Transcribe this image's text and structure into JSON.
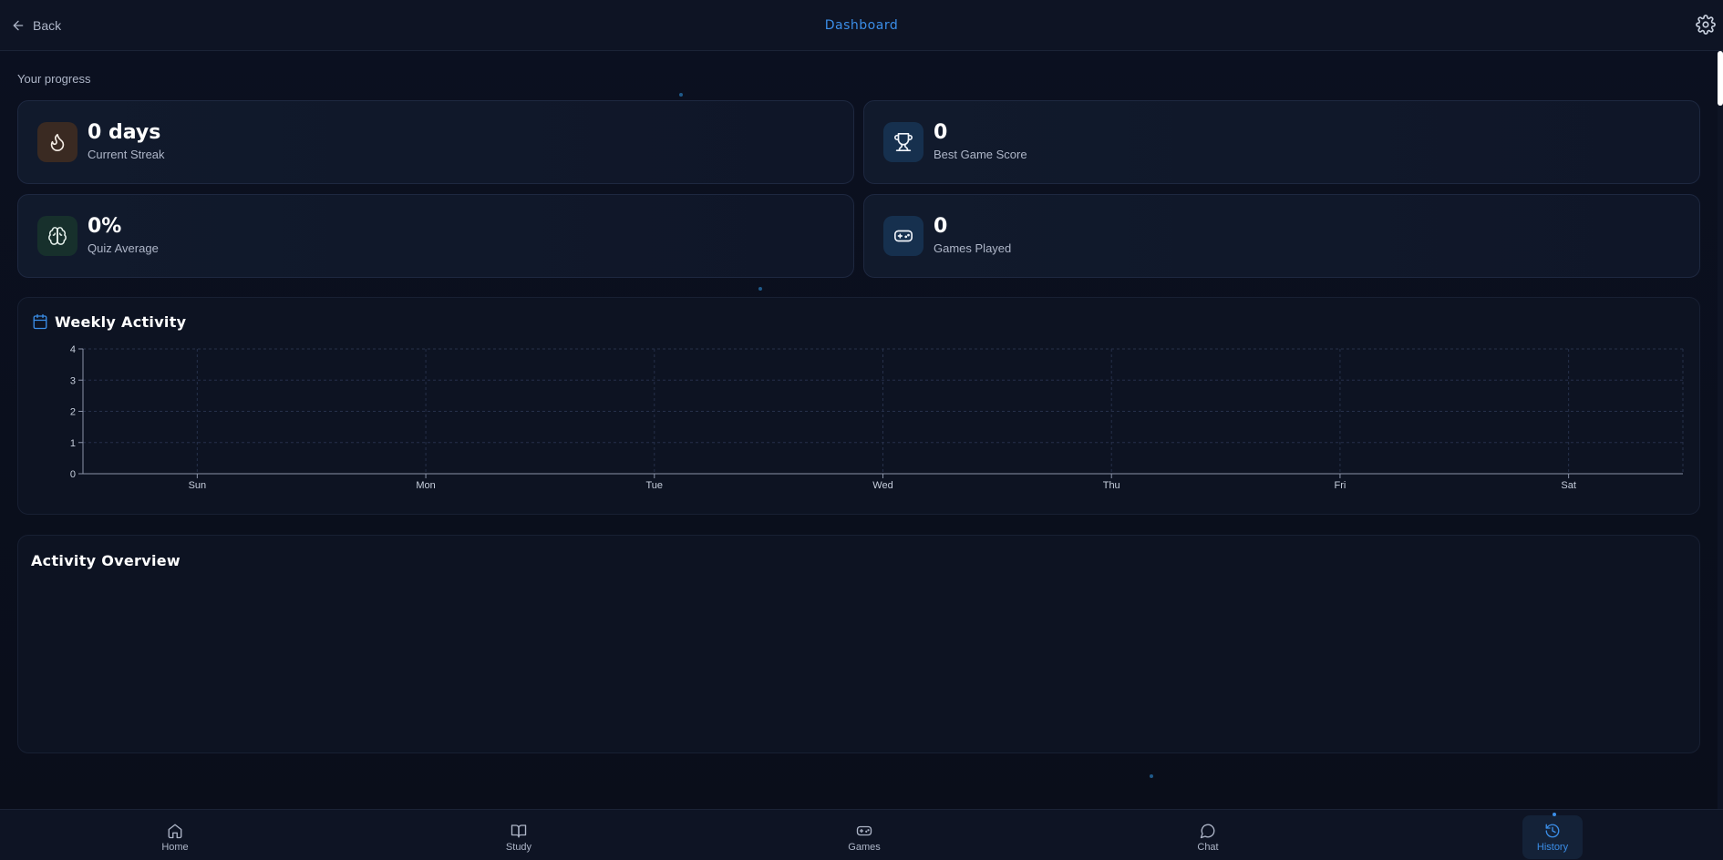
{
  "header": {
    "back_label": "Back",
    "title": "Dashboard"
  },
  "progress": {
    "section_label": "Your progress",
    "stats": [
      {
        "value": "0 days",
        "label": "Current Streak",
        "icon": "flame-icon",
        "color": "#f08a3c"
      },
      {
        "value": "0",
        "label": "Best Game Score",
        "icon": "trophy-icon",
        "color": "#3b8ee8"
      },
      {
        "value": "0%",
        "label": "Quiz Average",
        "icon": "brain-icon",
        "color": "#3fd19a"
      },
      {
        "value": "0",
        "label": "Games Played",
        "icon": "gamepad-icon",
        "color": "#3b8ee8"
      }
    ]
  },
  "weekly_activity": {
    "title": "Weekly Activity",
    "icon": "calendar-icon"
  },
  "activity_overview": {
    "title": "Activity Overview"
  },
  "chart_data": {
    "type": "bar",
    "title": "Weekly Activity",
    "categories": [
      "Sun",
      "Mon",
      "Tue",
      "Wed",
      "Thu",
      "Fri",
      "Sat"
    ],
    "values": [
      0,
      0,
      0,
      0,
      0,
      0,
      0
    ],
    "yticks": [
      "0",
      "1",
      "2",
      "3",
      "4"
    ],
    "ylim": [
      0,
      4
    ],
    "xlabel": "",
    "ylabel": "",
    "grid": true
  },
  "nav": {
    "items": [
      {
        "label": "Home",
        "icon": "home-icon"
      },
      {
        "label": "Study",
        "icon": "book-icon"
      },
      {
        "label": "Games",
        "icon": "gamepad-icon"
      },
      {
        "label": "Chat",
        "icon": "chat-icon"
      },
      {
        "label": "History",
        "icon": "history-icon"
      }
    ],
    "active": "History",
    "accent": "#3b8ee8"
  }
}
